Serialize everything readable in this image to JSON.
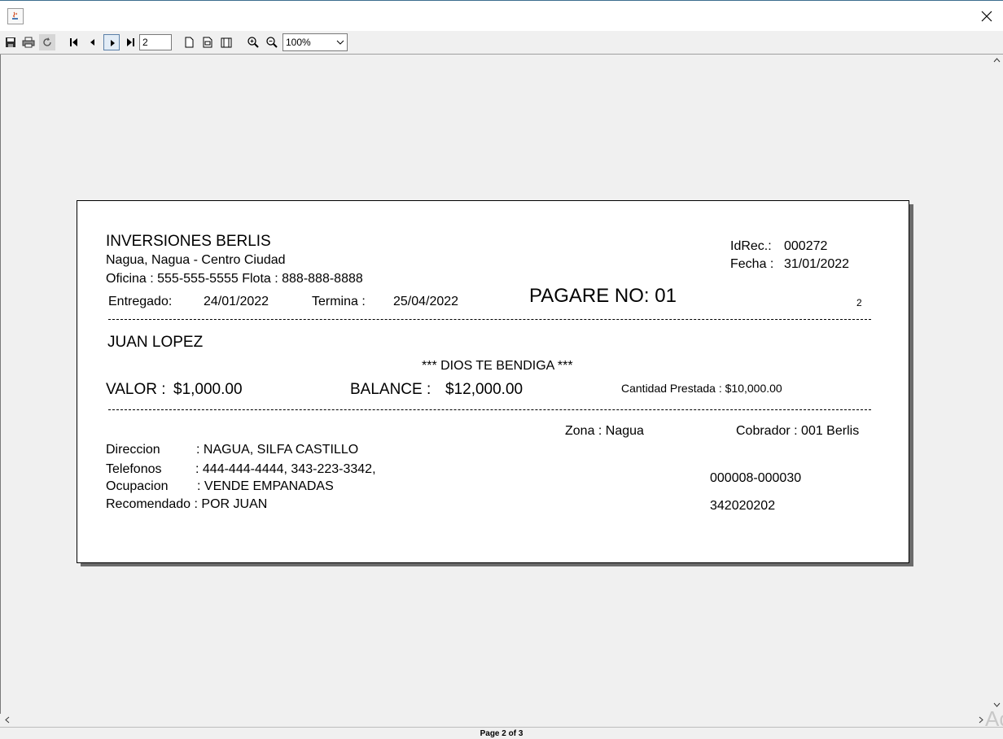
{
  "window": {
    "status_text": "Page 2 of 3",
    "watermark": "Ac"
  },
  "toolbar": {
    "page_number": "2",
    "zoom": "100%"
  },
  "report": {
    "company": "INVERSIONES BERLIS",
    "address": "Nagua, Nagua - Centro Ciudad",
    "phones": "Oficina : 555-555-5555  Flota : 888-888-8888",
    "idrec_label": "IdRec.:",
    "idrec_value": "000272",
    "fecha_label": "Fecha :",
    "fecha_value": "31/01/2022",
    "entregado_label": "Entregado:",
    "entregado_value": "24/01/2022",
    "termina_label": "Termina :",
    "termina_value": "25/04/2022",
    "pagare": "PAGARE NO: 01",
    "page_marker": "2",
    "client_name": "JUAN LOPEZ",
    "blessing": "*** DIOS TE BENDIGA ***",
    "valor_label": "VALOR :",
    "valor_value": "$1,000.00",
    "balance_label": "BALANCE :",
    "balance_value": "$12,000.00",
    "cantidad": "Cantidad Prestada : $10,000.00",
    "zona": "Zona : Nagua",
    "cobrador": "Cobrador : 001 Berlis",
    "direccion_label": "Direccion",
    "direccion_value": ": NAGUA, SILFA CASTILLO",
    "telefonos_label": "Telefonos",
    "telefonos_value": ": 444-444-4444, 343-223-3342,",
    "ocupacion_label": "Ocupacion",
    "ocupacion_value": ": VENDE EMPANADAS",
    "recomendado": "Recomendado : POR JUAN",
    "code1": "000008-000030",
    "code2": "342020202"
  }
}
